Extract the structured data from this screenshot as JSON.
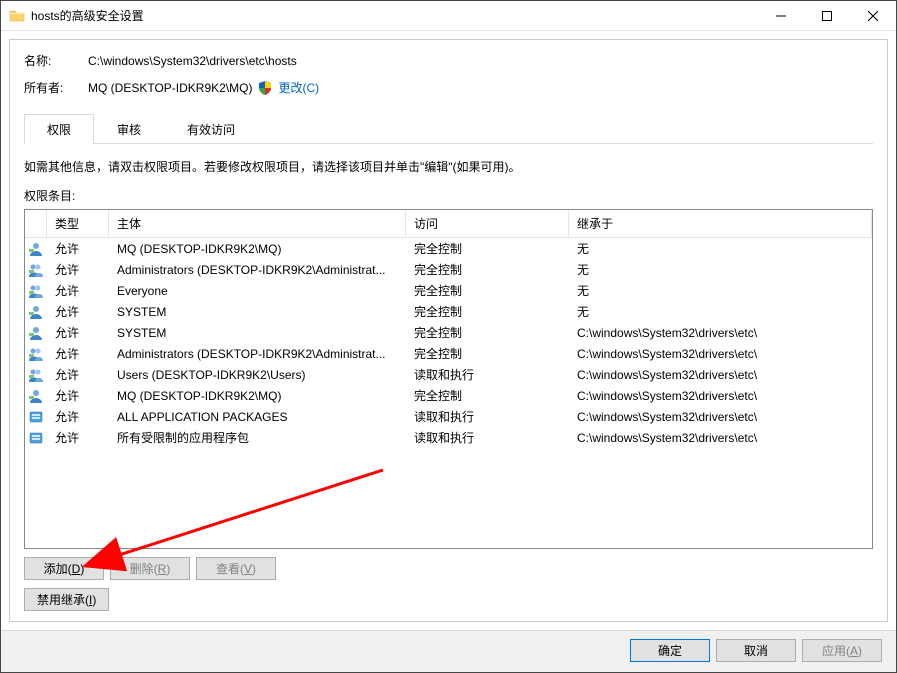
{
  "title": "hosts的高级安全设置",
  "name_label": "名称:",
  "name_value": "C:\\windows\\System32\\drivers\\etc\\hosts",
  "owner_label": "所有者:",
  "owner_value": "MQ (DESKTOP-IDKR9K2\\MQ)",
  "change_link": "更改(C)",
  "tabs": {
    "permissions": "权限",
    "audit": "审核",
    "effective": "有效访问"
  },
  "hint": "如需其他信息，请双击权限项目。若要修改权限项目，请选择该项目并单击\"编辑\"(如果可用)。",
  "entries_label": "权限条目:",
  "columns": {
    "type": "类型",
    "principal": "主体",
    "access": "访问",
    "inherit": "继承于"
  },
  "rows": [
    {
      "icon": "user",
      "type": "允许",
      "principal": "MQ (DESKTOP-IDKR9K2\\MQ)",
      "access": "完全控制",
      "inherit": "无"
    },
    {
      "icon": "group",
      "type": "允许",
      "principal": "Administrators (DESKTOP-IDKR9K2\\Administrat...",
      "access": "完全控制",
      "inherit": "无"
    },
    {
      "icon": "group",
      "type": "允许",
      "principal": "Everyone",
      "access": "完全控制",
      "inherit": "无"
    },
    {
      "icon": "user",
      "type": "允许",
      "principal": "SYSTEM",
      "access": "完全控制",
      "inherit": "无"
    },
    {
      "icon": "user",
      "type": "允许",
      "principal": "SYSTEM",
      "access": "完全控制",
      "inherit": "C:\\windows\\System32\\drivers\\etc\\"
    },
    {
      "icon": "group",
      "type": "允许",
      "principal": "Administrators (DESKTOP-IDKR9K2\\Administrat...",
      "access": "完全控制",
      "inherit": "C:\\windows\\System32\\drivers\\etc\\"
    },
    {
      "icon": "group",
      "type": "允许",
      "principal": "Users (DESKTOP-IDKR9K2\\Users)",
      "access": "读取和执行",
      "inherit": "C:\\windows\\System32\\drivers\\etc\\"
    },
    {
      "icon": "user",
      "type": "允许",
      "principal": "MQ (DESKTOP-IDKR9K2\\MQ)",
      "access": "完全控制",
      "inherit": "C:\\windows\\System32\\drivers\\etc\\"
    },
    {
      "icon": "pkg",
      "type": "允许",
      "principal": "ALL APPLICATION PACKAGES",
      "access": "读取和执行",
      "inherit": "C:\\windows\\System32\\drivers\\etc\\"
    },
    {
      "icon": "pkg",
      "type": "允许",
      "principal": "所有受限制的应用程序包",
      "access": "读取和执行",
      "inherit": "C:\\windows\\System32\\drivers\\etc\\"
    }
  ],
  "buttons": {
    "add": "添加(D)",
    "remove": "删除(R)",
    "view": "查看(V)",
    "disable_inherit": "禁用继承(I)",
    "ok": "确定",
    "cancel": "取消",
    "apply": "应用(A)"
  }
}
